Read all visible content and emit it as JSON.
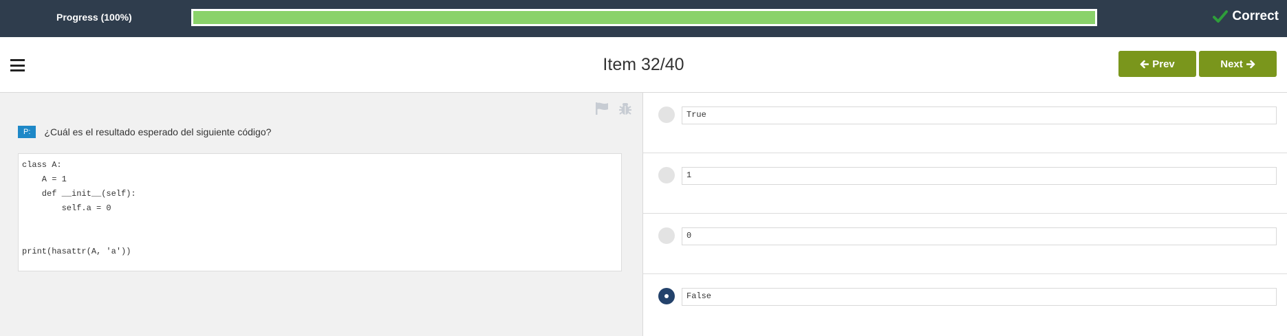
{
  "progress": {
    "label": "Progress (100%)",
    "value": 1.0,
    "status_text": "Correct",
    "colors": {
      "fill": "#8ad26a",
      "bar_bg": "#2f3d4d",
      "check": "#2e9e3a"
    }
  },
  "header": {
    "item_title": "Item 32/40",
    "prev_label": "Prev",
    "next_label": "Next",
    "button_color": "#7a961c"
  },
  "question": {
    "badge": "P:",
    "text": "¿Cuál es el resultado esperado del siguiente código?",
    "code": "class A:\n    A = 1\n    def __init__(self):\n        self.a = 0\n\n\nprint(hasattr(A, 'a'))"
  },
  "options": [
    {
      "label": "True",
      "selected": false
    },
    {
      "label": "1",
      "selected": false
    },
    {
      "label": "0",
      "selected": false
    },
    {
      "label": "False",
      "selected": true
    }
  ],
  "icons": [
    "menu-icon",
    "arrow-left-icon",
    "arrow-right-icon",
    "flag-icon",
    "bug-icon",
    "check-icon"
  ]
}
